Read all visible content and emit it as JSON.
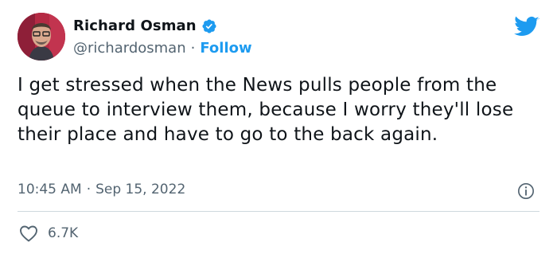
{
  "author": {
    "name": "Richard Osman",
    "handle": "@richardosman",
    "separator": "·",
    "follow_label": "Follow"
  },
  "tweet": {
    "text": "I get stressed when the News pulls people from the queue to interview them, because I worry they'll lose their place and have to go to the back again."
  },
  "meta": {
    "time": "10:45 AM",
    "separator": "·",
    "date": "Sep 15, 2022"
  },
  "engagement": {
    "likes": "6.7K"
  },
  "icons": {
    "verified": "verified-badge-icon",
    "brand": "twitter-bird-icon",
    "info": "info-icon",
    "like": "heart-icon"
  },
  "colors": {
    "accent": "#1d9bf0",
    "text": "#0f1419",
    "muted": "#536471",
    "divider": "#cfd9de"
  }
}
